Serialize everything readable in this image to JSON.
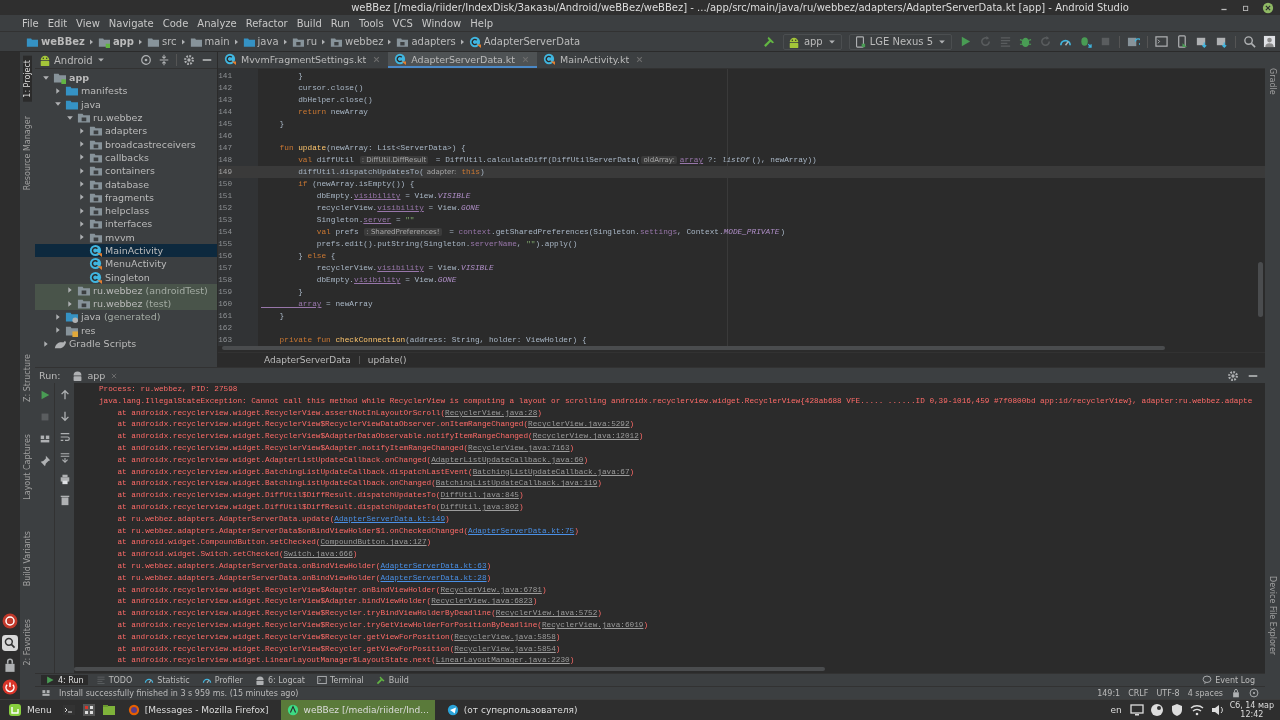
{
  "window": {
    "title": "weBBez [/media/riider/IndexDisk/Заказы/Android/weBBez/weBBez] - .../app/src/main/java/ru/webbez/adapters/AdapterServerData.kt [app] - Android Studio"
  },
  "menu": [
    "File",
    "Edit",
    "View",
    "Navigate",
    "Code",
    "Analyze",
    "Refactor",
    "Build",
    "Run",
    "Tools",
    "VCS",
    "Window",
    "Help"
  ],
  "breadcrumbs": [
    {
      "label": "weBBez",
      "kind": "project"
    },
    {
      "label": "app",
      "kind": "module"
    },
    {
      "label": "src",
      "kind": "folder"
    },
    {
      "label": "main",
      "kind": "folder"
    },
    {
      "label": "java",
      "kind": "source"
    },
    {
      "label": "ru",
      "kind": "package"
    },
    {
      "label": "webbez",
      "kind": "package"
    },
    {
      "label": "adapters",
      "kind": "package"
    },
    {
      "label": "AdapterServerData",
      "kind": "class"
    }
  ],
  "toolbar": {
    "run_config": "app",
    "device": "LGE Nexus 5"
  },
  "left_tool_tabs": [
    {
      "label": "1: Project",
      "selected": true
    },
    {
      "label": "Resource Manager",
      "selected": false
    }
  ],
  "lower_tool_tabs": [
    {
      "label": "Z: Structure"
    },
    {
      "label": "Layout Captures"
    },
    {
      "label": "Build Variants"
    },
    {
      "label": "2: Favorites"
    }
  ],
  "right_tool_tabs": [
    {
      "label": "Gradle"
    },
    {
      "label": "Device File Explorer"
    }
  ],
  "project": {
    "view": "Android",
    "tree": [
      {
        "label": "app",
        "kind": "module",
        "expanded": true,
        "selected": false,
        "children": [
          {
            "label": "manifests",
            "kind": "folder",
            "expanded": false,
            "selected": false
          },
          {
            "label": "java",
            "kind": "folder",
            "expanded": true,
            "selected": false,
            "children": [
              {
                "label": "ru.webbez",
                "kind": "package",
                "expanded": true,
                "selected": false,
                "children": [
                  {
                    "label": "adapters",
                    "kind": "package",
                    "expanded": false,
                    "selected": false
                  },
                  {
                    "label": "broadcastreceivers",
                    "kind": "package",
                    "expanded": false,
                    "selected": false
                  },
                  {
                    "label": "callbacks",
                    "kind": "package",
                    "expanded": false,
                    "selected": false
                  },
                  {
                    "label": "containers",
                    "kind": "package",
                    "expanded": false,
                    "selected": false
                  },
                  {
                    "label": "database",
                    "kind": "package",
                    "expanded": false,
                    "selected": false
                  },
                  {
                    "label": "fragments",
                    "kind": "package",
                    "expanded": false,
                    "selected": false
                  },
                  {
                    "label": "helpclass",
                    "kind": "package",
                    "expanded": false,
                    "selected": false
                  },
                  {
                    "label": "interfaces",
                    "kind": "package",
                    "expanded": false,
                    "selected": false
                  },
                  {
                    "label": "mvvm",
                    "kind": "package",
                    "expanded": false,
                    "selected": false
                  },
                  {
                    "label": "MainActivity",
                    "kind": "class",
                    "selected": true
                  },
                  {
                    "label": "MenuActivity",
                    "kind": "class",
                    "selected": false
                  },
                  {
                    "label": "Singleton",
                    "kind": "class",
                    "selected": false
                  }
                ]
              },
              {
                "label": "ru.webbez",
                "suffix": "(androidTest)",
                "kind": "test_package",
                "expanded": false,
                "selected": false
              },
              {
                "label": "ru.webbez",
                "suffix": "(test)",
                "kind": "test_package",
                "expanded": false,
                "selected": false
              }
            ]
          },
          {
            "label": "java",
            "suffix": "(generated)",
            "kind": "generated",
            "expanded": false,
            "selected": false
          },
          {
            "label": "res",
            "kind": "res",
            "expanded": false,
            "selected": false
          }
        ]
      },
      {
        "label": "Gradle Scripts",
        "kind": "gradle",
        "expanded": false,
        "selected": false
      }
    ]
  },
  "editor": {
    "tabs": [
      {
        "label": "MvvmFragmentSettings.kt",
        "selected": false
      },
      {
        "label": "AdapterServerData.kt",
        "selected": true
      },
      {
        "label": "MainActivity.kt",
        "selected": false
      }
    ],
    "lines": [
      {
        "number": "141",
        "current": false,
        "tokens": [
          {
            "text": "        }",
            "kind": "plain"
          }
        ]
      },
      {
        "number": "142",
        "current": false,
        "tokens": [
          {
            "text": "        cursor.close()",
            "kind": "plain"
          }
        ]
      },
      {
        "number": "143",
        "current": false,
        "tokens": [
          {
            "text": "        dbHelper.close()",
            "kind": "plain"
          }
        ]
      },
      {
        "number": "144",
        "current": false,
        "tokens": [
          {
            "text": "        return",
            "kind": "kw"
          },
          {
            "text": " newArray",
            "kind": "plain"
          }
        ]
      },
      {
        "number": "145",
        "current": false,
        "tokens": [
          {
            "text": "    }",
            "kind": "plain"
          }
        ]
      },
      {
        "number": "146",
        "current": false
      },
      {
        "number": "147",
        "current": false,
        "tokens": [
          {
            "text": "    fun ",
            "kind": "kw"
          },
          {
            "text": "update",
            "kind": "fn"
          },
          {
            "text": "(newArray: List<ServerData>) {",
            "kind": "plain"
          }
        ]
      },
      {
        "number": "148",
        "current": false,
        "tokens": [
          {
            "text": "        val ",
            "kind": "kw"
          },
          {
            "text": "diffUtil ",
            "kind": "plain"
          },
          {
            "text": ": DiffUtil.DiffResult",
            "kind": "hint"
          },
          {
            "text": " = DiffUtil.calculateDiff(DiffUtilServerData(",
            "kind": "plain"
          },
          {
            "text": "oldArray:",
            "kind": "hint"
          },
          {
            "text": "array",
            "kind": "prop_u"
          },
          {
            "text": " ?: ",
            "kind": "plain"
          },
          {
            "text": "listOf",
            "kind": "italic"
          },
          {
            "text": "(), newArray))",
            "kind": "plain"
          }
        ]
      },
      {
        "number": "149",
        "current": true,
        "tokens": [
          {
            "text": "        diffUtil.dispatchUpdatesTo(",
            "kind": "plain"
          },
          {
            "text": "adapter:",
            "kind": "hint"
          },
          {
            "text": "this",
            "kind": "kw"
          },
          {
            "text": ")",
            "kind": "plain"
          }
        ]
      },
      {
        "number": "150",
        "current": false,
        "tokens": [
          {
            "text": "        if ",
            "kind": "kw"
          },
          {
            "text": "(newArray.isEmpty()) {",
            "kind": "plain"
          }
        ]
      },
      {
        "number": "151",
        "current": false,
        "tokens": [
          {
            "text": "            dbEmpty.",
            "kind": "plain"
          },
          {
            "text": "visibility",
            "kind": "prop_u"
          },
          {
            "text": " = View.",
            "kind": "plain"
          },
          {
            "text": "VISIBLE",
            "kind": "const"
          }
        ]
      },
      {
        "number": "152",
        "current": false,
        "tokens": [
          {
            "text": "            recyclerView.",
            "kind": "plain"
          },
          {
            "text": "visibility",
            "kind": "prop_u"
          },
          {
            "text": " = View.",
            "kind": "plain"
          },
          {
            "text": "GONE",
            "kind": "const"
          }
        ]
      },
      {
        "number": "153",
        "current": false,
        "tokens": [
          {
            "text": "            Singleton.",
            "kind": "plain"
          },
          {
            "text": "server",
            "kind": "prop_u"
          },
          {
            "text": " = ",
            "kind": "plain"
          },
          {
            "text": "\"\"",
            "kind": "str"
          }
        ]
      },
      {
        "number": "154",
        "current": false,
        "tokens": [
          {
            "text": "            val ",
            "kind": "kw"
          },
          {
            "text": "prefs ",
            "kind": "plain"
          },
          {
            "text": ": SharedPreferences!",
            "kind": "hint"
          },
          {
            "text": " = ",
            "kind": "plain"
          },
          {
            "text": "context",
            "kind": "prop"
          },
          {
            "text": ".getSharedPreferences(Singleton.",
            "kind": "plain"
          },
          {
            "text": "settings",
            "kind": "prop"
          },
          {
            "text": ", Context.",
            "kind": "plain"
          },
          {
            "text": "MODE_PRIVATE",
            "kind": "const"
          },
          {
            "text": ")",
            "kind": "plain"
          }
        ]
      },
      {
        "number": "155",
        "current": false,
        "tokens": [
          {
            "text": "            prefs.edit().putString(Singleton.",
            "kind": "plain"
          },
          {
            "text": "serverName",
            "kind": "prop"
          },
          {
            "text": ", ",
            "kind": "plain"
          },
          {
            "text": "\"\"",
            "kind": "str"
          },
          {
            "text": ").apply()",
            "kind": "plain"
          }
        ]
      },
      {
        "number": "156",
        "current": false,
        "tokens": [
          {
            "text": "        } ",
            "kind": "plain"
          },
          {
            "text": "else",
            "kind": "kw"
          },
          {
            "text": " {",
            "kind": "plain"
          }
        ]
      },
      {
        "number": "157",
        "current": false,
        "tokens": [
          {
            "text": "            recyclerView.",
            "kind": "plain"
          },
          {
            "text": "visibility",
            "kind": "prop_u"
          },
          {
            "text": " = View.",
            "kind": "plain"
          },
          {
            "text": "VISIBLE",
            "kind": "const"
          }
        ]
      },
      {
        "number": "158",
        "current": false,
        "tokens": [
          {
            "text": "            dbEmpty.",
            "kind": "plain"
          },
          {
            "text": "visibility",
            "kind": "prop_u"
          },
          {
            "text": " = View.",
            "kind": "plain"
          },
          {
            "text": "GONE",
            "kind": "const"
          }
        ]
      },
      {
        "number": "159",
        "current": false,
        "tokens": [
          {
            "text": "        }",
            "kind": "plain"
          }
        ]
      },
      {
        "number": "160",
        "current": false,
        "tokens": [
          {
            "text": "        array",
            "kind": "prop_u"
          },
          {
            "text": " = newArray",
            "kind": "plain"
          }
        ]
      },
      {
        "number": "161",
        "current": false,
        "tokens": [
          {
            "text": "    }",
            "kind": "plain"
          }
        ]
      },
      {
        "number": "162",
        "current": false
      },
      {
        "number": "163",
        "current": false,
        "tokens": [
          {
            "text": "    private fun ",
            "kind": "kw"
          },
          {
            "text": "checkConnection",
            "kind": "fn"
          },
          {
            "text": "(address: String, holder: ViewHolder) {",
            "kind": "plain"
          }
        ]
      }
    ],
    "breadcrumb": [
      "AdapterServerData",
      "update()"
    ]
  },
  "run": {
    "label": "Run:",
    "tab": "app",
    "log": [
      {
        "kind": "message",
        "text": "Process: ru.webbez, PID: 27598"
      },
      {
        "kind": "message",
        "text": "java.lang.IllegalStateException: Cannot call this method while RecyclerView is computing a layout or scrolling androidx.recyclerview.widget.RecyclerView{428ab688 VFE..... ......ID 0,39-1016,459 #7f0800bd app:id/recyclerView}, adapter:ru.webbez.adapte"
      },
      {
        "kind": "frame",
        "before": "at androidx.recyclerview.widget.RecyclerView.assertNotInLayoutOrScroll(",
        "link": "RecyclerView.java:28",
        "after": ")",
        "project": false
      },
      {
        "kind": "frame",
        "before": "at androidx.recyclerview.widget.RecyclerView$RecyclerViewDataObserver.onItemRangeChanged(",
        "link": "RecyclerView.java:5292",
        "after": ")",
        "project": false
      },
      {
        "kind": "frame",
        "before": "at androidx.recyclerview.widget.RecyclerView$AdapterDataObservable.notifyItemRangeChanged(",
        "link": "RecyclerView.java:12012",
        "after": ")",
        "project": false
      },
      {
        "kind": "frame",
        "before": "at androidx.recyclerview.widget.RecyclerView$Adapter.notifyItemRangeChanged(",
        "link": "RecyclerView.java:7163",
        "after": ")",
        "project": false
      },
      {
        "kind": "frame",
        "before": "at androidx.recyclerview.widget.AdapterListUpdateCallback.onChanged(",
        "link": "AdapterListUpdateCallback.java:60",
        "after": ")",
        "project": false
      },
      {
        "kind": "frame",
        "before": "at androidx.recyclerview.widget.BatchingListUpdateCallback.dispatchLastEvent(",
        "link": "BatchingListUpdateCallback.java:67",
        "after": ")",
        "project": false
      },
      {
        "kind": "frame",
        "before": "at androidx.recyclerview.widget.BatchingListUpdateCallback.onChanged(",
        "link": "BatchingListUpdateCallback.java:119",
        "after": ")",
        "project": false
      },
      {
        "kind": "frame",
        "before": "at androidx.recyclerview.widget.DiffUtil$DiffResult.dispatchUpdatesTo(",
        "link": "DiffUtil.java:845",
        "after": ")",
        "project": false
      },
      {
        "kind": "frame",
        "before": "at androidx.recyclerview.widget.DiffUtil$DiffResult.dispatchUpdatesTo(",
        "link": "DiffUtil.java:802",
        "after": ")",
        "project": false
      },
      {
        "kind": "frame",
        "before": "at ru.webbez.adapters.AdapterServerData.update(",
        "link": "AdapterServerData.kt:149",
        "after": ")",
        "project": true
      },
      {
        "kind": "frame",
        "before": "at ru.webbez.adapters.AdapterServerData$onBindViewHolder$1.onCheckedChanged(",
        "link": "AdapterServerData.kt:75",
        "after": ")",
        "project": true
      },
      {
        "kind": "frame",
        "before": "at android.widget.CompoundButton.setChecked(",
        "link": "CompoundButton.java:127",
        "after": ")",
        "project": false
      },
      {
        "kind": "frame",
        "before": "at android.widget.Switch.setChecked(",
        "link": "Switch.java:666",
        "after": ")",
        "project": false
      },
      {
        "kind": "frame",
        "before": "at ru.webbez.adapters.AdapterServerData.onBindViewHolder(",
        "link": "AdapterServerData.kt:63",
        "after": ")",
        "project": true
      },
      {
        "kind": "frame",
        "before": "at ru.webbez.adapters.AdapterServerData.onBindViewHolder(",
        "link": "AdapterServerData.kt:28",
        "after": ")",
        "project": true
      },
      {
        "kind": "frame",
        "before": "at androidx.recyclerview.widget.RecyclerView$Adapter.onBindViewHolder(",
        "link": "RecyclerView.java:6781",
        "after": ")",
        "project": false
      },
      {
        "kind": "frame",
        "before": "at androidx.recyclerview.widget.RecyclerView$Adapter.bindViewHolder(",
        "link": "RecyclerView.java:6823",
        "after": ")",
        "project": false
      },
      {
        "kind": "frame",
        "before": "at androidx.recyclerview.widget.RecyclerView$Recycler.tryBindViewHolderByDeadline(",
        "link": "RecyclerView.java:5752",
        "after": ")",
        "project": false
      },
      {
        "kind": "frame",
        "before": "at androidx.recyclerview.widget.RecyclerView$Recycler.tryGetViewHolderForPositionByDeadline(",
        "link": "RecyclerView.java:6019",
        "after": ")",
        "project": false
      },
      {
        "kind": "frame",
        "before": "at androidx.recyclerview.widget.RecyclerView$Recycler.getViewForPosition(",
        "link": "RecyclerView.java:5858",
        "after": ")",
        "project": false
      },
      {
        "kind": "frame",
        "before": "at androidx.recyclerview.widget.RecyclerView$Recycler.getViewForPosition(",
        "link": "RecyclerView.java:5854",
        "after": ")",
        "project": false
      },
      {
        "kind": "frame",
        "before": "at androidx.recyclerview.widget.LinearLayoutManager$LayoutState.next(",
        "link": "LinearLayoutManager.java:2230",
        "after": ")",
        "project": false
      }
    ]
  },
  "bottom_tabs": [
    {
      "label": "4: Run",
      "selected": true
    },
    {
      "label": "TODO",
      "selected": false
    },
    {
      "label": "Statistic",
      "selected": false
    },
    {
      "label": "Profiler",
      "selected": false
    },
    {
      "label": "6: Logcat",
      "selected": false
    },
    {
      "label": "Terminal",
      "selected": false
    },
    {
      "label": "Build",
      "selected": false
    }
  ],
  "event_log": "Event Log",
  "status_bar": {
    "message": "Install successfully finished in 3 s 959 ms. (15 minutes ago)",
    "items": [
      "149:1",
      "CRLF",
      "UTF-8",
      "4 spaces"
    ]
  },
  "taskbar": {
    "menu": "Menu",
    "windows": [
      {
        "label": "[Messages - Mozilla Firefox]",
        "selected": false
      },
      {
        "label": "weBBez [/media/riider/Ind...",
        "selected": true
      },
      {
        "label": "(от суперпользователя)",
        "selected": false
      }
    ],
    "layout": "en",
    "date": "Сб, 14 мар",
    "time": "12:42"
  }
}
